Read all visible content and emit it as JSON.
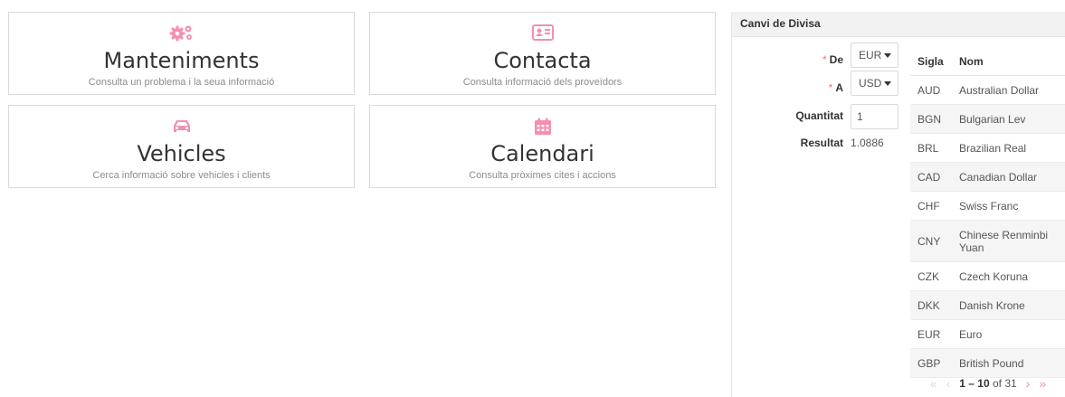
{
  "cards": [
    {
      "title": "Manteniments",
      "subtitle": "Consulta un problema i la seua informació",
      "icon": "gears-icon"
    },
    {
      "title": "Contacta",
      "subtitle": "Consulta informació dels proveïdors",
      "icon": "contact-card-icon"
    },
    {
      "title": "Vehicles",
      "subtitle": "Cerca informació sobre vehicles i clients",
      "icon": "car-icon"
    },
    {
      "title": "Calendari",
      "subtitle": "Consulta pròximes cites i accions",
      "icon": "calendar-icon"
    }
  ],
  "accent_color": "#f48fb1",
  "currency": {
    "title": "Canvi de Divisa",
    "from_label": "De",
    "from_value": "EUR",
    "to_label": "A",
    "to_value": "USD",
    "quantity_label": "Quantitat",
    "quantity_value": "1",
    "result_label": "Resultat",
    "result_value": "1.0886",
    "required_mark": "*",
    "table": {
      "headers": [
        "Sigla",
        "Nom"
      ],
      "rows": [
        [
          "AUD",
          "Australian Dollar"
        ],
        [
          "BGN",
          "Bulgarian Lev"
        ],
        [
          "BRL",
          "Brazilian Real"
        ],
        [
          "CAD",
          "Canadian Dollar"
        ],
        [
          "CHF",
          "Swiss Franc"
        ],
        [
          "CNY",
          "Chinese Renminbi Yuan"
        ],
        [
          "CZK",
          "Czech Koruna"
        ],
        [
          "DKK",
          "Danish Krone"
        ],
        [
          "EUR",
          "Euro"
        ],
        [
          "GBP",
          "British Pound"
        ]
      ]
    },
    "pager": {
      "range": "1 – 10",
      "of_text": "of 31"
    }
  }
}
